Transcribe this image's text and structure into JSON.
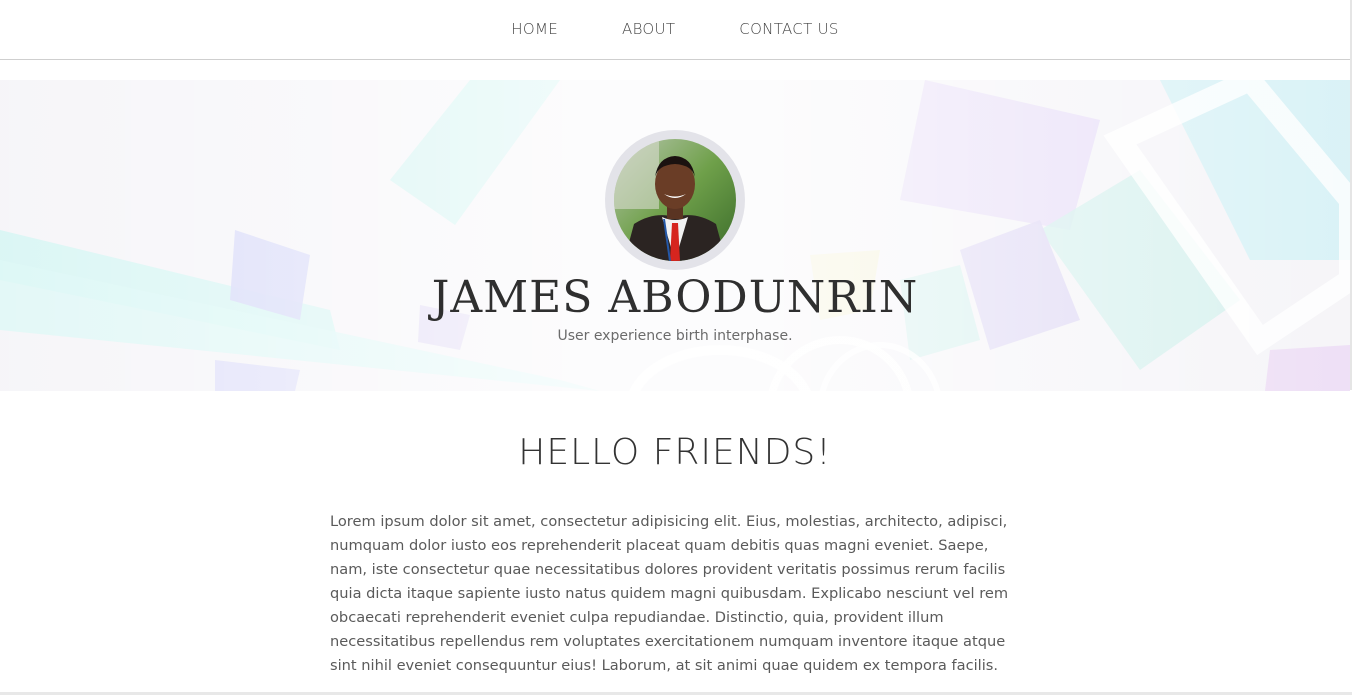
{
  "nav": {
    "items": [
      {
        "label": "HOME",
        "name": "nav-home"
      },
      {
        "label": "ABOUT",
        "name": "nav-about"
      },
      {
        "label": "CONTACT US",
        "name": "nav-contact"
      }
    ]
  },
  "hero": {
    "name": "JAMES ABODUNRIN",
    "tagline": "User experience birth interphase."
  },
  "content": {
    "heading": "HELLO FRIENDS!",
    "body": "Lorem ipsum dolor sit amet, consectetur adipisicing elit. Eius, molestias, architecto, adipisci, numquam dolor iusto eos reprehenderit placeat quam debitis quas magni eveniet. Saepe, nam, iste consectetur quae necessitatibus dolores provident veritatis possimus rerum facilis quia dicta itaque sapiente iusto natus quidem magni quibusdam. Explicabo nesciunt vel rem obcaecati reprehenderit eveniet culpa repudiandae. Distinctio, quia, provident illum necessitatibus repellendus rem voluptates exercitationem numquam inventore itaque atque sint nihil eveniet consequuntur eius! Laborum, at sit animi quae quidem ex tempora facilis."
  },
  "colors": {
    "text": "#333333",
    "muted": "#6b6b6b",
    "divider": "#cfcfcf"
  }
}
